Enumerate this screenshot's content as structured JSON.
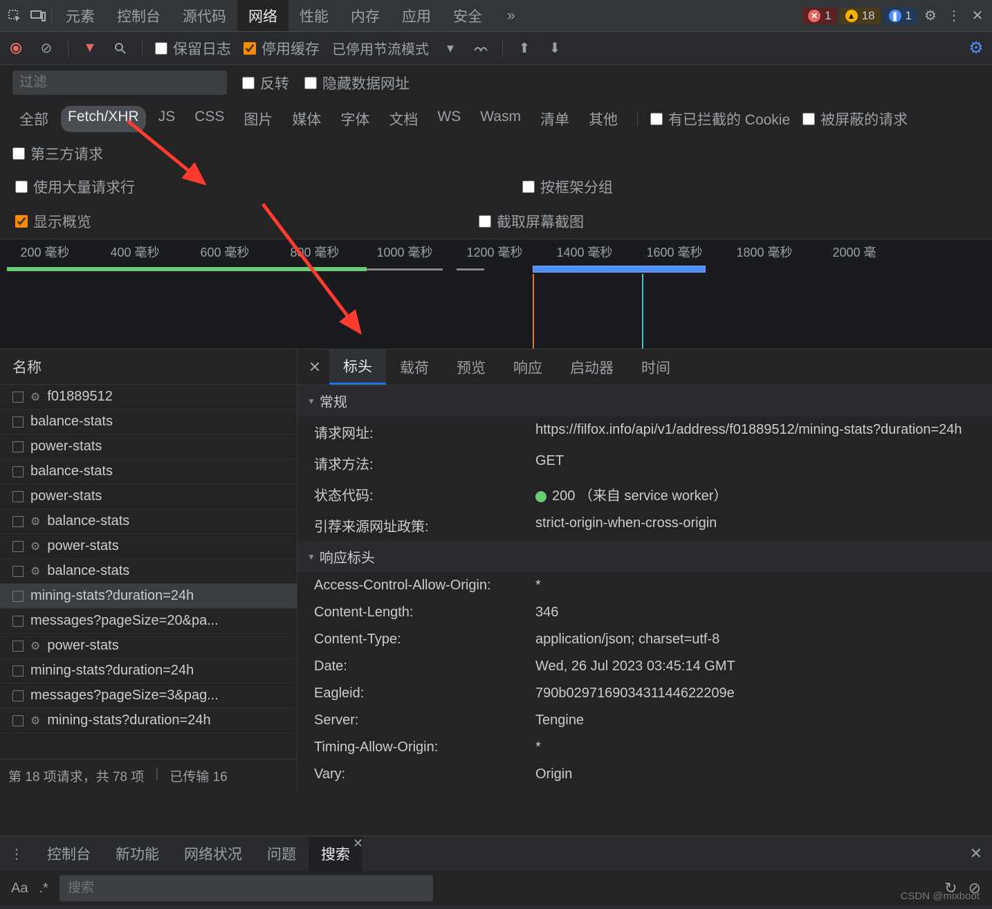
{
  "tabs": {
    "items": [
      "元素",
      "控制台",
      "源代码",
      "网络",
      "性能",
      "内存",
      "应用",
      "安全"
    ],
    "active": 3,
    "more": "»"
  },
  "badges": {
    "error": "1",
    "warn": "18",
    "info": "1"
  },
  "toolbar": {
    "preserve": "保留日志",
    "disable_cache": "停用缓存",
    "throttle": "已停用节流模式"
  },
  "filter": {
    "placeholder": "过滤",
    "invert": "反转",
    "hide_data": "隐藏数据网址"
  },
  "types": [
    "全部",
    "Fetch/XHR",
    "JS",
    "CSS",
    "图片",
    "媒体",
    "字体",
    "文档",
    "WS",
    "Wasm",
    "清单",
    "其他"
  ],
  "types_sel": 1,
  "type_opts": {
    "blocked": "有已拦截的 Cookie",
    "shielded": "被屏蔽的请求",
    "thirdparty": "第三方请求"
  },
  "opt": {
    "large": "使用大量请求行",
    "group": "按框架分组",
    "overview": "显示概览",
    "screenshot": "截取屏幕截图"
  },
  "ticks": [
    "200 毫秒",
    "400 毫秒",
    "600 毫秒",
    "800 毫秒",
    "1000 毫秒",
    "1200 毫秒",
    "1400 毫秒",
    "1600 毫秒",
    "1800 毫秒",
    "2000 毫"
  ],
  "reqhdr": "名称",
  "requests": [
    {
      "gear": true,
      "name": "f01889512"
    },
    {
      "gear": false,
      "name": "balance-stats"
    },
    {
      "gear": false,
      "name": "power-stats"
    },
    {
      "gear": false,
      "name": "balance-stats"
    },
    {
      "gear": false,
      "name": "power-stats"
    },
    {
      "gear": true,
      "name": "balance-stats"
    },
    {
      "gear": true,
      "name": "power-stats"
    },
    {
      "gear": true,
      "name": "balance-stats"
    },
    {
      "gear": false,
      "name": "mining-stats?duration=24h",
      "sel": true
    },
    {
      "gear": false,
      "name": "messages?pageSize=20&pa..."
    },
    {
      "gear": true,
      "name": "power-stats"
    },
    {
      "gear": false,
      "name": "mining-stats?duration=24h"
    },
    {
      "gear": false,
      "name": "messages?pageSize=3&pag..."
    },
    {
      "gear": true,
      "name": "mining-stats?duration=24h"
    }
  ],
  "footer": {
    "count": "第 18 项请求，共 78 项",
    "xfer": "已传输 16"
  },
  "dtabs": [
    "标头",
    "载荷",
    "预览",
    "响应",
    "启动器",
    "时间"
  ],
  "dtabs_active": 0,
  "sect_general": "常规",
  "general": [
    {
      "k": "请求网址:",
      "v": "https://filfox.info/api/v1/address/f01889512/mining-stats?duration=24h"
    },
    {
      "k": "请求方法:",
      "v": "GET"
    },
    {
      "k": "状态代码:",
      "v": "200 （来自 service worker）",
      "status": true
    },
    {
      "k": "引荐来源网址政策:",
      "v": "strict-origin-when-cross-origin"
    }
  ],
  "sect_resp": "响应标头",
  "resp": [
    {
      "k": "Access-Control-Allow-Origin:",
      "v": "*"
    },
    {
      "k": "Content-Length:",
      "v": "346"
    },
    {
      "k": "Content-Type:",
      "v": "application/json; charset=utf-8"
    },
    {
      "k": "Date:",
      "v": "Wed, 26 Jul 2023 03:45:14 GMT"
    },
    {
      "k": "Eagleid:",
      "v": "790b029716903431144622209e"
    },
    {
      "k": "Server:",
      "v": "Tengine"
    },
    {
      "k": "Timing-Allow-Origin:",
      "v": "*"
    },
    {
      "k": "Vary:",
      "v": "Origin"
    }
  ],
  "drawer": {
    "tabs": [
      "控制台",
      "新功能",
      "网络状况",
      "问题",
      "搜索"
    ],
    "active": 4
  },
  "search": {
    "placeholder": "搜索",
    "aa": "Aa",
    "rx": ".*"
  },
  "watermark": "CSDN @mixboot"
}
